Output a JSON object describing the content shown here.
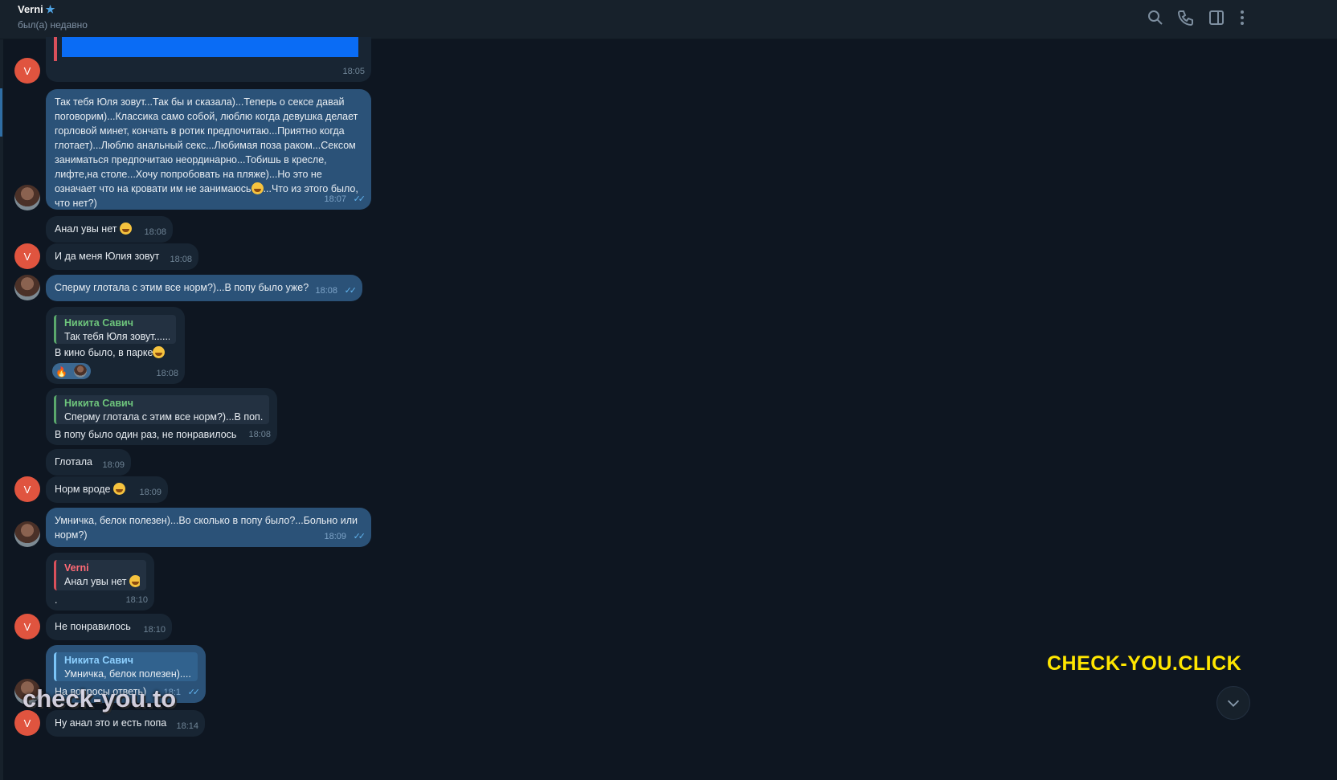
{
  "header": {
    "title": "Verni",
    "status": "был(а) недавно"
  },
  "messages": {
    "m0": {
      "time": "18:05"
    },
    "m1": {
      "text": "Так тебя Юля зовут...Так бы и сказала)...Теперь о сексе давай поговорим)...Классика само собой, люблю когда девушка делает горловой минет, кончать в ротик предпочитаю...Приятно когда глотает)...Люблю анальный секс...Любимая поза раком...Сексом заниматься предпочитаю неординарно...Тобишь в кресле, лифте,на столе...Хочу попробовать на пляже)...Но это не означает что на кровати им не занимаюсь",
      "text2": "...Что из этого было, что нет?)",
      "time": "18:07"
    },
    "m2": {
      "text": "Анал увы нет",
      "time": "18:08"
    },
    "m3": {
      "text": "И да меня Юлия зовут",
      "time": "18:08"
    },
    "m4": {
      "text": "Сперму глотала с этим все норм?)...В попу было уже?",
      "time": "18:08"
    },
    "m5": {
      "reply_name": "Никита Савич",
      "reply_text": "Так тебя Юля зовут......",
      "text": "В кино было, в парке",
      "time": "18:08"
    },
    "m6": {
      "reply_name": "Никита Савич",
      "reply_text": "Сперму глотала с этим все норм?)...В поп...",
      "text": "В попу было один раз, не понравилось",
      "time": "18:08"
    },
    "m7": {
      "text": "Глотала",
      "time": "18:09"
    },
    "m8": {
      "text": "Норм вроде",
      "time": "18:09"
    },
    "m9": {
      "text": "Умничка, белок полезен)...Во сколько в попу было?...Больно или норм?)",
      "time": "18:09"
    },
    "m10": {
      "reply_name": "Verni",
      "reply_text": "Анал увы нет",
      "text": ".",
      "time": "18:10"
    },
    "m11": {
      "text": "Не понравилось",
      "time": "18:10"
    },
    "m12": {
      "reply_name": "Никита Савич",
      "reply_text": "Умничка, белок полезен).....",
      "text": "На вопросы ответь)",
      "time": "18:1"
    },
    "m13": {
      "text": "Ну анал это и есть попа",
      "time": "18:14"
    }
  },
  "avatar_letter": "V",
  "reaction_emoji": "🔥",
  "watermarks": {
    "big": "CHECK-YOU.CLICK",
    "small": "check-you.to"
  },
  "colors": {
    "background": "#0e1621",
    "incoming": "#182533",
    "outgoing": "#2b5278",
    "accent": "#4fa3e3",
    "watermark": "#ffe600"
  },
  "icons": [
    "search-icon",
    "phone-icon",
    "sidebar-icon",
    "more-icon",
    "chevron-down-icon"
  ]
}
